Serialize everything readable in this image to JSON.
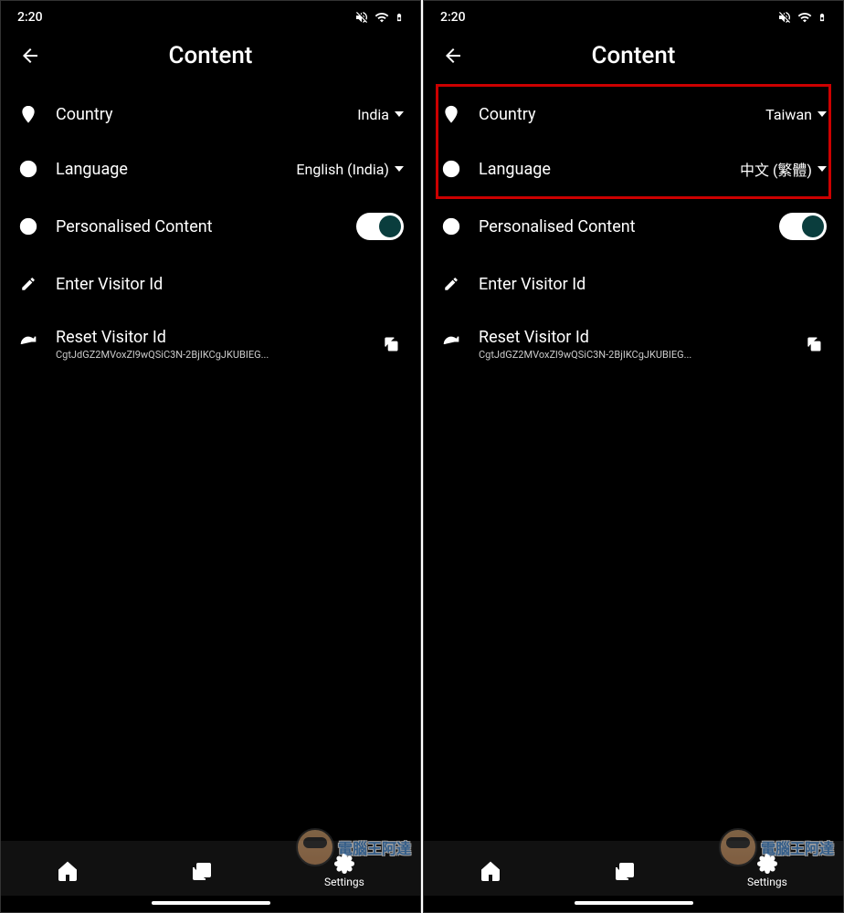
{
  "screens": [
    {
      "status": {
        "time": "2:20"
      },
      "header": {
        "title": "Content"
      },
      "rows": {
        "country": {
          "label": "Country",
          "value": "India"
        },
        "language": {
          "label": "Language",
          "value": "English (India)"
        },
        "personalised": {
          "label": "Personalised Content",
          "toggle": true
        },
        "visitor_id": {
          "label": "Enter Visitor Id"
        },
        "reset": {
          "label": "Reset Visitor Id",
          "sub": "CgtJdGZ2MVoxZl9wQSiC3N-2BjIKCgJKUBIEG..."
        }
      },
      "highlight": false
    },
    {
      "status": {
        "time": "2:20"
      },
      "header": {
        "title": "Content"
      },
      "rows": {
        "country": {
          "label": "Country",
          "value": "Taiwan"
        },
        "language": {
          "label": "Language",
          "value": "中文 (繁體)"
        },
        "personalised": {
          "label": "Personalised Content",
          "toggle": true
        },
        "visitor_id": {
          "label": "Enter Visitor Id"
        },
        "reset": {
          "label": "Reset Visitor Id",
          "sub": "CgtJdGZ2MVoxZl9wQSiC3N-2BjIKCgJKUBIEG..."
        }
      },
      "highlight": true
    }
  ],
  "nav": {
    "settings": "Settings"
  },
  "watermark": {
    "cn": "電腦王阿達",
    "url": "http://..."
  }
}
